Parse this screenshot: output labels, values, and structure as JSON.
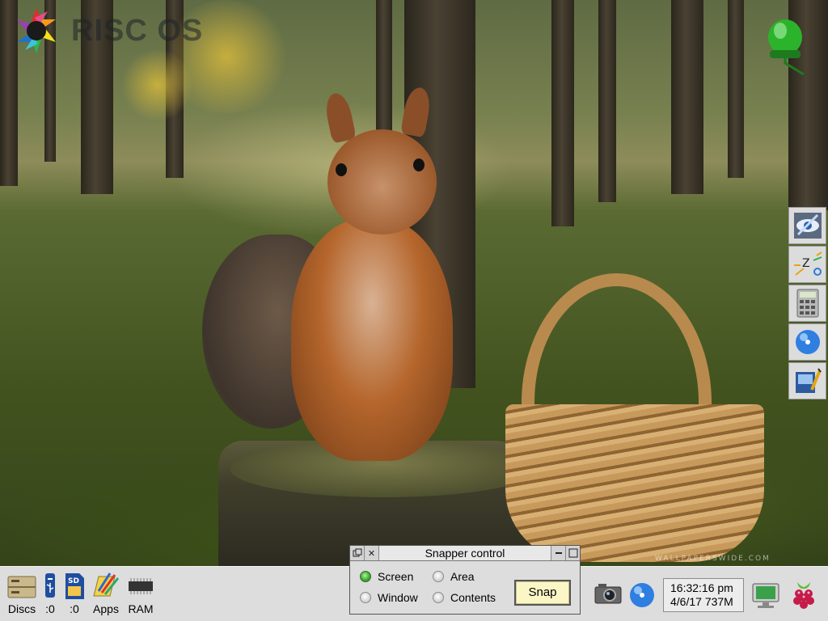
{
  "desktop": {
    "logo_text": "RISC OS",
    "watermark": "WALLPAPERSWIDE.COM"
  },
  "pinboard": {
    "icons": [
      "eye-tool-icon",
      "sleep-tool-icon",
      "calculator-icon",
      "globe-icon",
      "paint-icon"
    ]
  },
  "iconbar": {
    "left_items": [
      {
        "label": "Discs",
        "icon": "hard-disc-icon"
      },
      {
        "label": ":0",
        "icon": "usb-icon"
      },
      {
        "label": ":0",
        "icon": "sd-card-icon"
      },
      {
        "label": "Apps",
        "icon": "apps-icon"
      },
      {
        "label": "RAM",
        "icon": "ram-chip-icon"
      }
    ],
    "right_items": [
      "camera-icon",
      "globe-icon",
      "monitor-icon",
      "raspberry-pi-icon"
    ],
    "clock": {
      "time": "16:32:16 pm",
      "date_mem": "4/6/17 737M"
    }
  },
  "snapper": {
    "title": "Snapper control",
    "options": [
      {
        "label": "Screen",
        "selected": true
      },
      {
        "label": "Area",
        "selected": false
      },
      {
        "label": "Window",
        "selected": false
      },
      {
        "label": "Contents",
        "selected": false
      }
    ],
    "snap_label": "Snap"
  }
}
